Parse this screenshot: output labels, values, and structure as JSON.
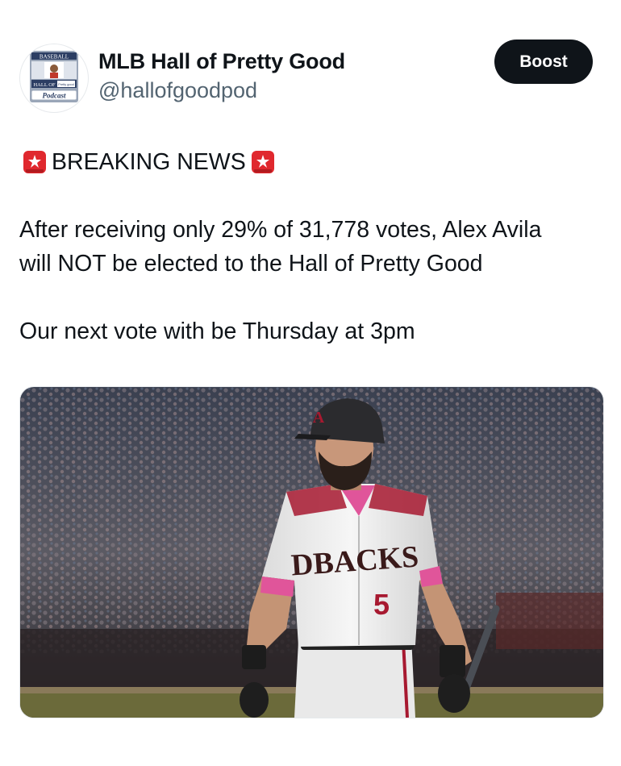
{
  "account": {
    "display_name": "MLB Hall of Pretty Good",
    "handle": "@hallofgoodpod",
    "avatar_icon": "hall-of-pretty-good-podcast-logo",
    "avatar_text": {
      "top": "BASEBALL",
      "middle": "HALL OF",
      "small": "Pretty good",
      "bottom": "Podcast"
    }
  },
  "actions": {
    "boost_label": "Boost"
  },
  "tweet": {
    "heading": "BREAKING NEWS",
    "heading_icon": "siren-emoji",
    "lines": [
      "After receiving only 29% of 31,778 votes, Alex Avila",
      "will NOT be elected to the Hall of Pretty Good"
    ],
    "followup": "Our next vote with be Thursday at 3pm"
  },
  "media": {
    "type": "photo",
    "jersey_text": "DBACKS",
    "jersey_number": "5",
    "helmet_letter": "A"
  },
  "colors": {
    "accent_dark": "#0f1419",
    "handle_gray": "#536471",
    "dbacks_red": "#a71930",
    "siren_red": "#e0282e"
  }
}
